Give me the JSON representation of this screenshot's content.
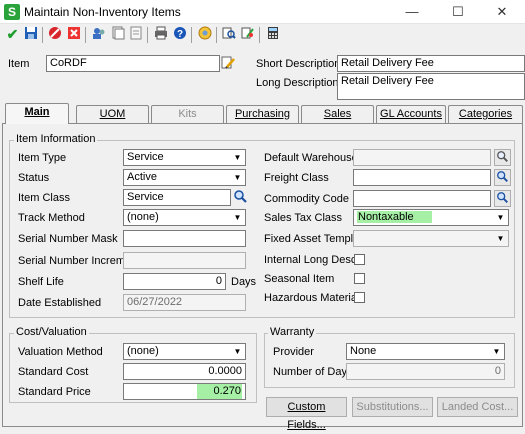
{
  "window": {
    "title": "Maintain Non-Inventory Items",
    "app_icon": "S",
    "minimize": "—",
    "maximize": "☐",
    "close": "✕"
  },
  "toolbar": {
    "icons": [
      "check-icon",
      "save-icon",
      "delete-icon",
      "cancel-icon",
      "people-icon",
      "copy-icon",
      "notes-icon",
      "print-icon",
      "help-icon",
      "settings-icon",
      "lookup-icon",
      "lookup-edit-icon",
      "calculator-icon"
    ]
  },
  "header": {
    "item_label": "Item",
    "item_value": "CoRDF",
    "short_desc_label": "Short Description",
    "short_desc_value": "Retail Delivery Fee",
    "long_desc_label": "Long Description",
    "long_desc_value": "Retail Delivery Fee"
  },
  "tabs": [
    {
      "label": "Main",
      "state": "active"
    },
    {
      "label": "UOM",
      "state": "normal"
    },
    {
      "label": "Kits",
      "state": "disabled"
    },
    {
      "label": "Purchasing",
      "state": "normal"
    },
    {
      "label": "Sales",
      "state": "normal"
    },
    {
      "label": "GL Accounts",
      "state": "normal"
    },
    {
      "label": "Categories",
      "state": "normal"
    }
  ],
  "item_info": {
    "group_title": "Item Information",
    "item_type_label": "Item Type",
    "item_type_value": "Service",
    "status_label": "Status",
    "status_value": "Active",
    "item_class_label": "Item Class",
    "item_class_value": "Service",
    "track_method_label": "Track Method",
    "track_method_value": "(none)",
    "serial_mask_label": "Serial Number Mask",
    "serial_mask_value": "",
    "serial_incr_label": "Serial Number Increment",
    "serial_incr_value": "",
    "shelf_life_label": "Shelf Life",
    "shelf_life_value": "0",
    "shelf_life_unit": "Days",
    "date_est_label": "Date Established",
    "date_est_value": "06/27/2022",
    "default_wh_label": "Default Warehouse",
    "default_wh_value": "",
    "freight_class_label": "Freight Class",
    "freight_class_value": "",
    "commodity_label": "Commodity Code",
    "commodity_value": "",
    "sales_tax_label": "Sales Tax Class",
    "sales_tax_value": "Nontaxable",
    "fixed_asset_label": "Fixed Asset Template",
    "fixed_asset_value": "",
    "internal_long_label": "Internal Long Desc",
    "seasonal_label": "Seasonal Item",
    "hazardous_label": "Hazardous Material",
    "internal_long_checked": false,
    "seasonal_checked": false,
    "hazardous_checked": false
  },
  "cost": {
    "group_title": "Cost/Valuation",
    "valuation_label": "Valuation Method",
    "valuation_value": "(none)",
    "std_cost_label": "Standard Cost",
    "std_cost_value": "0.0000",
    "std_price_label": "Standard Price",
    "std_price_value": "0.270"
  },
  "warranty": {
    "group_title": "Warranty",
    "provider_label": "Provider",
    "provider_value": "None",
    "days_label": "Number of Days",
    "days_value": "0"
  },
  "buttons": {
    "custom_fields": "Custom Fields...",
    "substitutions": "Substitutions...",
    "landed_cost": "Landed Cost..."
  },
  "colors": {
    "highlight": "#a6f0a6",
    "app_icon": "#2aa43a"
  }
}
